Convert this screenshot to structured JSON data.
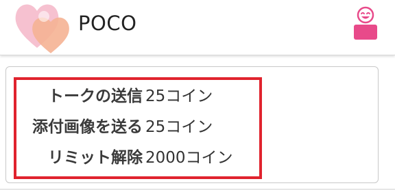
{
  "header": {
    "title": "POCO",
    "logo_icon": "hearts-logo-icon",
    "profile_icon": "user-profile-icon",
    "accent_color": "#e84a8a"
  },
  "pricing": {
    "rows": [
      {
        "label": "トークの送信",
        "value": "25コイン"
      },
      {
        "label": "添付画像を送る",
        "value": "25コイン"
      },
      {
        "label": "リミット解除",
        "value": "2000コイン"
      }
    ],
    "highlight_color": "#e0232e"
  }
}
